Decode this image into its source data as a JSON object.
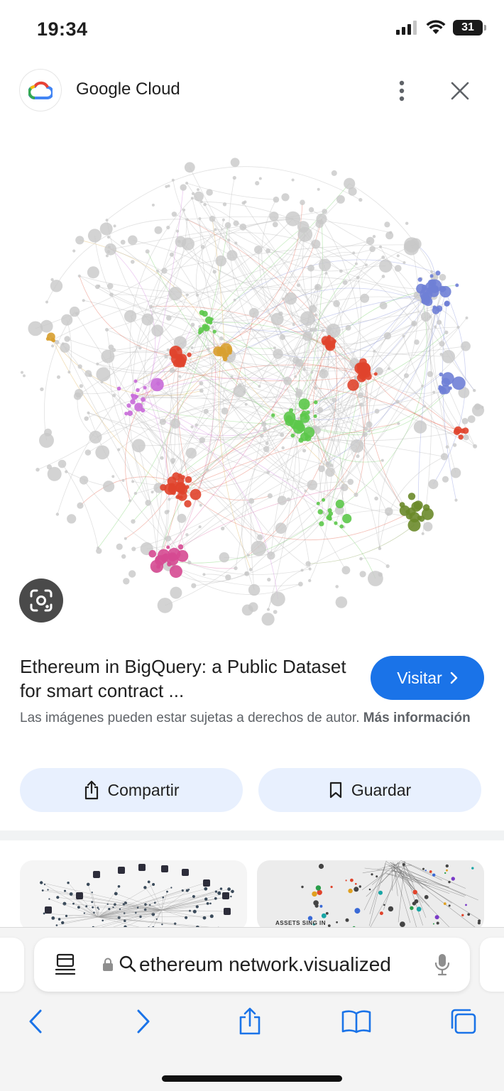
{
  "status_bar": {
    "time": "19:34",
    "battery_level": "31"
  },
  "header": {
    "site_name": "Google Cloud"
  },
  "image": {
    "alt": "Ethereum network visualized"
  },
  "result": {
    "title": "Ethereum in BigQuery: a Public Dataset for smart contract ...",
    "visit_label": "Visitar",
    "copyright_text": "Las imágenes pueden estar sujetas a derechos de autor.",
    "copyright_link": "Más información"
  },
  "actions": {
    "share_label": "Compartir",
    "save_label": "Guardar"
  },
  "related_thumbs": [
    {
      "caption": ""
    },
    {
      "caption": "ASSETS SING IN"
    }
  ],
  "browser": {
    "url": "ethereum network.visualized"
  },
  "colors": {
    "accent": "#1a73e8",
    "pill_bg": "#e8f0fe",
    "node_gray": "#c8c8c8",
    "red": "#e0442c",
    "green": "#5cc84a",
    "blue": "#6f7fd6",
    "purple": "#c86ad8",
    "pink": "#d64a92",
    "orange": "#d8a030",
    "olive": "#6a8a2a"
  }
}
